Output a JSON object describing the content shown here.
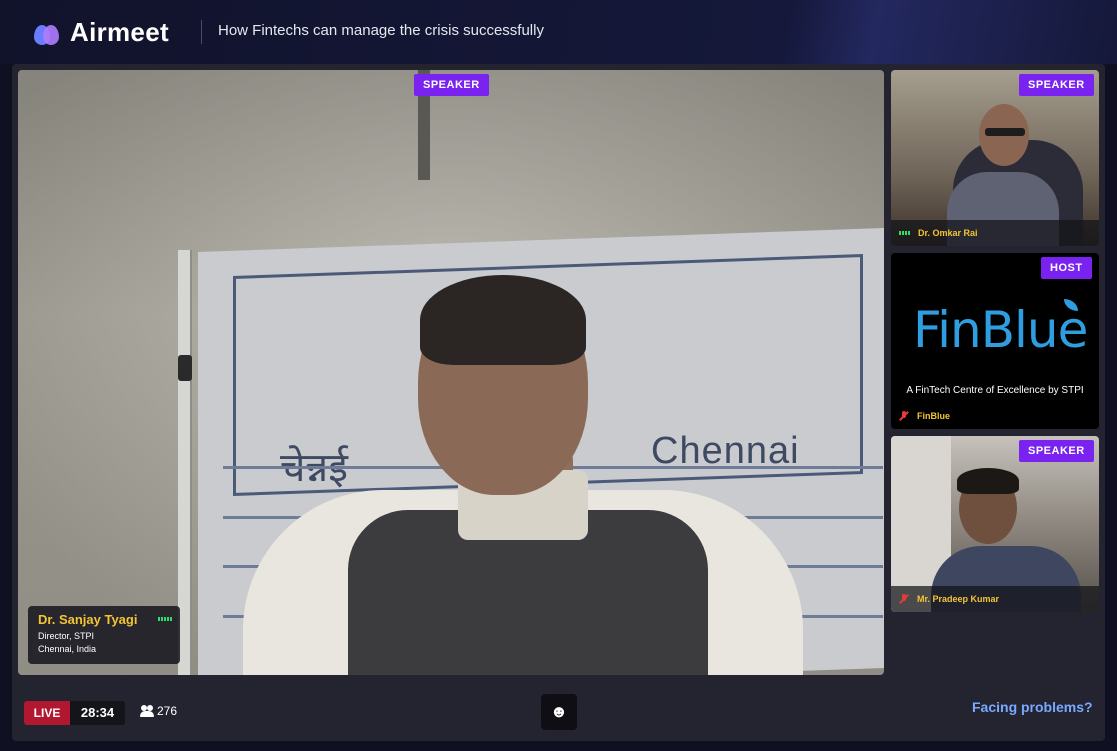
{
  "header": {
    "brand": "Airmeet",
    "event_title": "How Fintechs can manage the crisis successfully"
  },
  "main_speaker": {
    "badge": "SPEAKER",
    "name": "Dr. Sanjay Tyagi",
    "title": "Director, STPI",
    "location": "Chennai, India",
    "backdrop_hindi": "चेन्नई",
    "backdrop_city": "Chennai"
  },
  "side_tiles": [
    {
      "badge": "SPEAKER",
      "name": "Dr. Omkar Rai",
      "audio": "speaking"
    },
    {
      "badge": "HOST",
      "name": "FinBlue",
      "audio": "muted",
      "logo_text": "FinBlue",
      "tagline": "A FinTech Centre of Excellence by STPI"
    },
    {
      "badge": "SPEAKER",
      "name": "Mr. Pradeep Kumar",
      "audio": "muted"
    }
  ],
  "footer": {
    "live_label": "LIVE",
    "timer": "28:34",
    "viewer_count": "276",
    "reaction_icon": "☻",
    "help_link": "Facing problems?"
  },
  "colors": {
    "accent_badge": "#7a23f0",
    "live": "#b1172f",
    "name_highlight": "#f3c535",
    "link": "#7aa8ff"
  }
}
